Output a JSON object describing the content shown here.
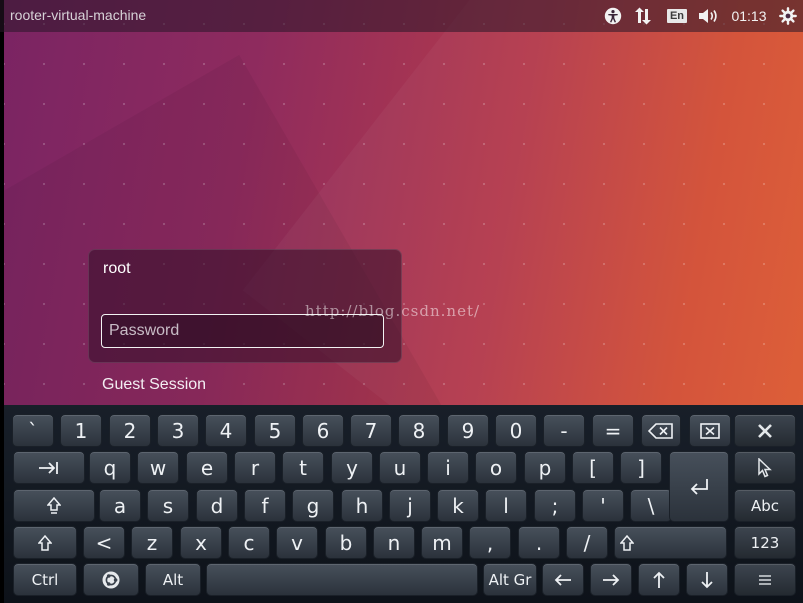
{
  "top_panel": {
    "hostname": "rooter-virtual-machine",
    "language": "En",
    "clock": "01:13",
    "icons": [
      "accessibility-icon",
      "network-icon",
      "keyboard-language-indicator",
      "volume-icon",
      "power-gear-icon"
    ]
  },
  "login": {
    "user": "root",
    "password_placeholder": "Password",
    "guest_session": "Guest Session"
  },
  "watermark": "http://blog.csdn.net/",
  "keyboard": {
    "row1": [
      "`",
      "1",
      "2",
      "3",
      "4",
      "5",
      "6",
      "7",
      "8",
      "9",
      "0",
      "-",
      "="
    ],
    "row2": [
      "q",
      "w",
      "e",
      "r",
      "t",
      "y",
      "u",
      "i",
      "o",
      "p",
      "[",
      "]"
    ],
    "row3": [
      "a",
      "s",
      "d",
      "f",
      "g",
      "h",
      "j",
      "k",
      "l",
      ";",
      "'",
      "\\"
    ],
    "row4": [
      "<",
      "z",
      "x",
      "c",
      "v",
      "b",
      "n",
      "m",
      ",",
      ".",
      "/"
    ],
    "ctrl": "Ctrl",
    "alt": "Alt",
    "altgr": "Alt Gr",
    "abc": "Abc",
    "num": "123"
  }
}
